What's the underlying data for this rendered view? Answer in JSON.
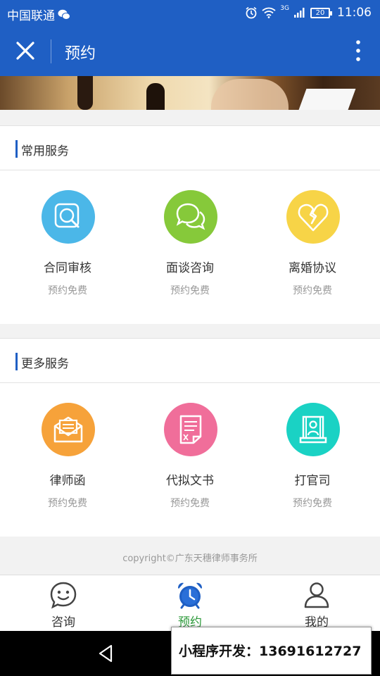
{
  "status_bar": {
    "carrier": "中国联通",
    "network": "3G",
    "battery": "20",
    "time": "11:06"
  },
  "nav": {
    "title": "预约"
  },
  "sections": [
    {
      "title": "常用服务",
      "items": [
        {
          "title": "合同审核",
          "sub": "预约免费",
          "icon": "magnifier-document-icon",
          "color": "#4bb7e8"
        },
        {
          "title": "面谈咨询",
          "sub": "预约免费",
          "icon": "chat-bubbles-icon",
          "color": "#86c93a"
        },
        {
          "title": "离婚协议",
          "sub": "预约免费",
          "icon": "broken-heart-icon",
          "color": "#f7d447"
        }
      ]
    },
    {
      "title": "更多服务",
      "items": [
        {
          "title": "律师函",
          "sub": "预约免费",
          "icon": "envelope-icon",
          "color": "#f6a23a"
        },
        {
          "title": "代拟文书",
          "sub": "预约免费",
          "icon": "document-icon",
          "color": "#f06e9a"
        },
        {
          "title": "打官司",
          "sub": "预约免费",
          "icon": "courtroom-icon",
          "color": "#1ad2c4"
        }
      ]
    }
  ],
  "copyright": "copyright©广东天穗律师事务所",
  "tabs": [
    {
      "label": "咨询",
      "icon": "smiley-icon"
    },
    {
      "label": "预约",
      "icon": "alarm-clock-icon",
      "active": true,
      "active_color": "#2d9a3b"
    },
    {
      "label": "我的",
      "icon": "user-icon"
    }
  ],
  "promo": "小程序开发：13691612727"
}
